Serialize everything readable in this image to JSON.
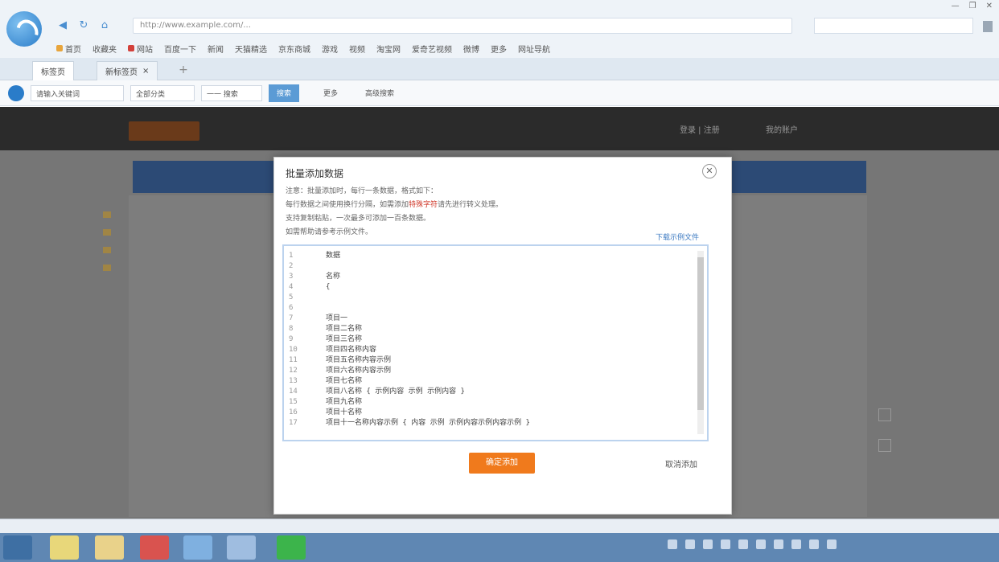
{
  "browser": {
    "url": "http://www.example.com/...",
    "window_controls": [
      "—",
      "❐",
      "✕"
    ],
    "bookmarks": [
      {
        "label": "首页",
        "icon": "folder-icon"
      },
      {
        "label": "收藏夹",
        "icon": "folder-icon"
      },
      {
        "label": "网站",
        "icon": "red-icon"
      },
      {
        "label": "百度一下",
        "icon": ""
      },
      {
        "label": "新闻",
        "icon": ""
      },
      {
        "label": "天猫精选",
        "icon": ""
      },
      {
        "label": "京东商城",
        "icon": ""
      },
      {
        "label": "游戏",
        "icon": ""
      },
      {
        "label": "视频",
        "icon": ""
      },
      {
        "label": "淘宝网",
        "icon": ""
      },
      {
        "label": "爱奇艺视频",
        "icon": ""
      },
      {
        "label": "微博",
        "icon": ""
      },
      {
        "label": "更多",
        "icon": ""
      },
      {
        "label": "网址导航",
        "icon": ""
      }
    ],
    "tabs": [
      {
        "label": "标签页",
        "active": true
      },
      {
        "label": "新标签页",
        "active": false
      }
    ]
  },
  "toolbar2": {
    "field1": "请输入关键词",
    "field2": "全部分类",
    "field3": "一一 搜索",
    "button": "搜索",
    "plain1": "更多",
    "plain2": "高级搜索"
  },
  "site": {
    "header_links": [
      "登录 | 注册",
      "我的账户"
    ],
    "content_text": ""
  },
  "modal": {
    "title": "批量添加数据",
    "close": "✕",
    "desc_line1": "注意：批量添加时，每行一条数据，格式如下：",
    "desc_line2a": "每行数据之间使用换行分隔，如需添加",
    "desc_line2_highlight": "特殊字符",
    "desc_line2b": "请先进行转义处理。",
    "desc_line3": "支持复制粘贴，一次最多可添加一百条数据。",
    "desc_line4": "如需帮助请参考示例文件。",
    "link": "下载示例文件",
    "code_lines": [
      {
        "no": "1",
        "text": "数据"
      },
      {
        "no": "2",
        "text": ""
      },
      {
        "no": "3",
        "text": "名称"
      },
      {
        "no": "4",
        "text": "{"
      },
      {
        "no": "5",
        "text": ""
      },
      {
        "no": "6",
        "text": ""
      },
      {
        "no": "7",
        "text": "项目一"
      },
      {
        "no": "8",
        "text": "项目二名称"
      },
      {
        "no": "9",
        "text": "项目三名称"
      },
      {
        "no": "10",
        "text": "项目四名称内容"
      },
      {
        "no": "11",
        "text": "项目五名称内容示例"
      },
      {
        "no": "12",
        "text": "项目六名称内容示例"
      },
      {
        "no": "13",
        "text": "项目七名称"
      },
      {
        "no": "14",
        "text": "项目八名称  { 示例内容  示例 示例内容 }"
      },
      {
        "no": "15",
        "text": "项目九名称"
      },
      {
        "no": "16",
        "text": "项目十名称"
      },
      {
        "no": "17",
        "text": "项目十一名称内容示例  { 内容  示例  示例内容示例内容示例 }"
      }
    ],
    "primary_button": "确定添加",
    "secondary_link": "取消添加"
  },
  "statusbar": {
    "text": ""
  },
  "taskbar": {
    "clock_time": "",
    "clock_date": ""
  }
}
